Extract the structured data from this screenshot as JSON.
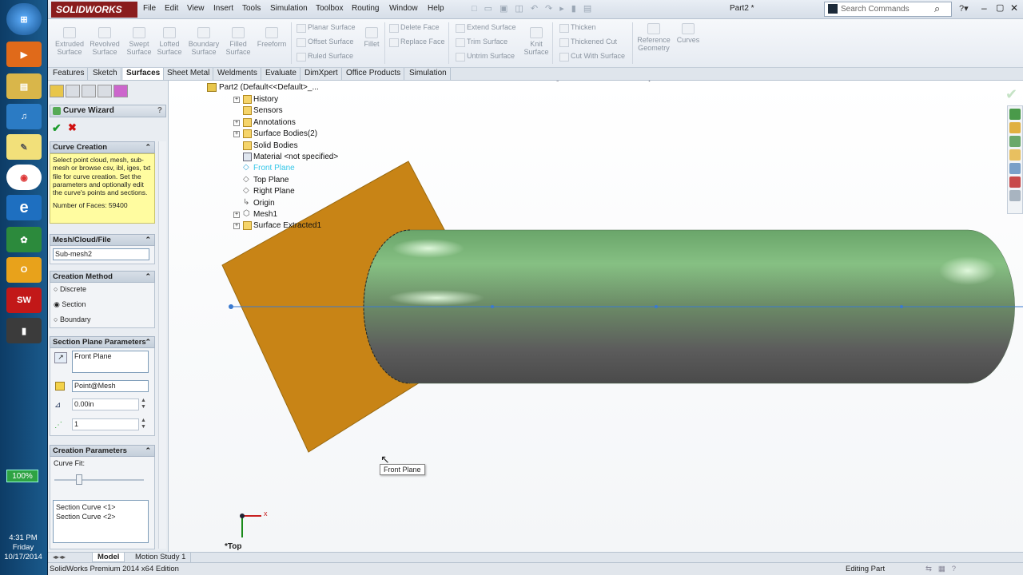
{
  "taskbar": {
    "battery": "100%",
    "time": "4:31 PM",
    "day": "Friday",
    "date": "10/17/2014"
  },
  "title": {
    "app": "SOLIDWORKS",
    "document": "Part2 *",
    "search_placeholder": "Search Commands"
  },
  "menu": [
    "File",
    "Edit",
    "View",
    "Insert",
    "Tools",
    "Simulation",
    "Toolbox",
    "Routing",
    "Window",
    "Help"
  ],
  "ribbon": {
    "big": [
      {
        "l1": "Extruded",
        "l2": "Surface"
      },
      {
        "l1": "Revolved",
        "l2": "Surface"
      },
      {
        "l1": "Swept",
        "l2": "Surface"
      },
      {
        "l1": "Lofted",
        "l2": "Surface"
      },
      {
        "l1": "Boundary",
        "l2": "Surface"
      },
      {
        "l1": "Filled",
        "l2": "Surface"
      },
      {
        "l1": "Freeform",
        "l2": ""
      }
    ],
    "col1": [
      "Planar Surface",
      "Offset Surface",
      "Ruled Surface"
    ],
    "fillet": "Fillet",
    "col2": [
      "Delete Face",
      "Replace Face"
    ],
    "col3": [
      "Extend Surface",
      "Trim Surface",
      "Untrim Surface"
    ],
    "knit": {
      "l1": "Knit",
      "l2": "Surface"
    },
    "col4": [
      "Thicken",
      "Thickened Cut",
      "Cut With Surface"
    ],
    "ref": {
      "l1": "Reference",
      "l2": "Geometry"
    },
    "curves": "Curves"
  },
  "tabs": [
    "Features",
    "Sketch",
    "Surfaces",
    "Sheet Metal",
    "Weldments",
    "Evaluate",
    "DimXpert",
    "Office Products",
    "Simulation"
  ],
  "pm": {
    "title": "Curve Wizard",
    "sections": {
      "creation": "Curve Creation",
      "mesh": "Mesh/Cloud/File",
      "method": "Creation Method",
      "plane": "Section Plane Parameters",
      "params": "Creation Parameters"
    },
    "message": "Select point cloud, mesh, sub-mesh or browse csv, ibl, iges, txt file for curve creation. Set the parameters and optionally edit the curve's points and sections.",
    "faces": "Number of Faces: 59400",
    "mesh_value": "Sub-mesh2",
    "methods": [
      "Discrete",
      "Section",
      "Boundary"
    ],
    "plane_value": "Front Plane",
    "point_value": "Point@Mesh",
    "offset_value": "0.00in",
    "count_value": "1",
    "curve_fit": "Curve Fit:",
    "curves": [
      "Section Curve <1>",
      "Section Curve <2>"
    ]
  },
  "tree": {
    "root": "Part2  (Default<<Default>_...",
    "items": [
      "History",
      "Sensors",
      "Annotations",
      "Surface Bodies(2)",
      "Solid Bodies",
      "Material <not specified>",
      "Front Plane",
      "Top Plane",
      "Right Plane",
      "Origin",
      "Mesh1",
      "Surface Extracted1"
    ]
  },
  "viewport": {
    "tooltip": "Front Plane",
    "view_label": "*Top",
    "axis_x": "x"
  },
  "bottom_tabs": [
    "Model",
    "Motion Study 1"
  ],
  "status": {
    "left": "SolidWorks Premium 2014 x64 Edition",
    "right": "Editing Part"
  }
}
